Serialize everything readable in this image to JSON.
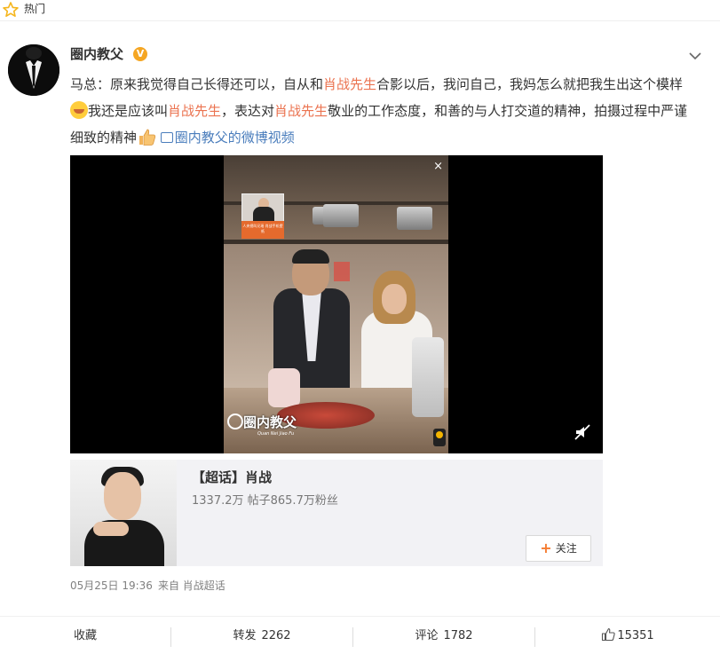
{
  "topbar": {
    "label": "热门",
    "icon": "star-outline-icon",
    "icon_color": "#f5b61e"
  },
  "author": {
    "name": "圈内教父",
    "verified_badge": "V",
    "badge_color": "#f5a623"
  },
  "post": {
    "seg1": "马总：原来我觉得自己长得还可以，自从和",
    "mention1": "肖战先生",
    "seg2": "合影以后，我问自己，我妈怎么就把我生出这个模样",
    "seg3": "我还是应该叫",
    "mention2": "肖战先生",
    "seg4": "，表达对",
    "mention3": "肖战先生",
    "seg5": "敬业的工作态度，和善的与人打交道的精神，拍摄过程中严谨细致的精神",
    "video_link": "圈内教父的微博视频",
    "highlight_color": "#eb7350",
    "link_color": "#4a7dbc"
  },
  "video": {
    "close_label": "×",
    "watermark_main": "圈内教父",
    "watermark_sub": "Quan Nei Jiao Fu",
    "pip_caption": "人央视叫兄瑶 肖战手机壁纸"
  },
  "topic_card": {
    "title": "【超话】肖战",
    "stats": "1337.2万 帖子865.7万粉丝",
    "follow_label": "关注",
    "follow_plus": "+"
  },
  "meta": {
    "date": "05月25日 19:36",
    "source": "来自 肖战超话"
  },
  "actions": {
    "favorite_label": "收藏",
    "repost_label": "转发",
    "repost_count": "2262",
    "comment_label": "评论",
    "comment_count": "1782",
    "like_count": "15351"
  }
}
